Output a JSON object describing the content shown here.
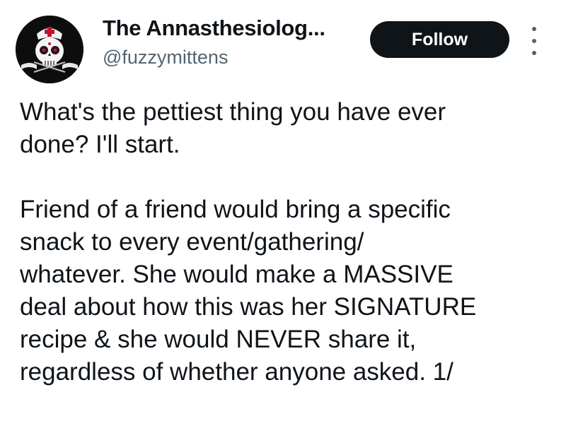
{
  "author": {
    "display_name": "The Annasthesiolog...",
    "handle": "@fuzzymittens",
    "avatar_icon": "sugar-skull-nurse-avatar"
  },
  "actions": {
    "follow_label": "Follow",
    "more_icon": "more-vertical-icon"
  },
  "tweet": {
    "paragraph1": [
      "What's the pettiest thing you have ever",
      "done?  I'll start."
    ],
    "paragraph2": [
      "Friend of a friend would bring a specific",
      "snack to every event/gathering/",
      "whatever.  She would make a MASSIVE",
      "deal about how this was her SIGNATURE",
      "recipe & she would NEVER share it,",
      "regardless of whether anyone asked. 1/"
    ]
  },
  "colors": {
    "text": "#0f1419",
    "secondary_text": "#536471",
    "follow_bg": "#0f1419",
    "follow_text": "#ffffff",
    "avatar_accent": "#c8102e"
  }
}
